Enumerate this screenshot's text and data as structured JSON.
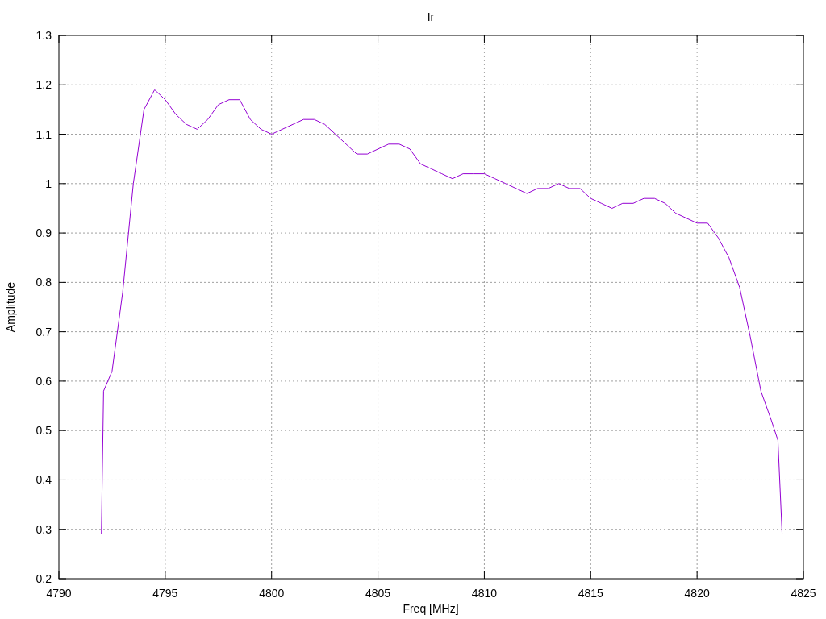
{
  "chart_data": {
    "type": "line",
    "title": "Ir",
    "xlabel": "Freq [MHz]",
    "ylabel": "Amplitude",
    "xlim": [
      4790,
      4825
    ],
    "ylim": [
      0.2,
      1.3
    ],
    "grid": true,
    "xticks": [
      4790,
      4795,
      4800,
      4805,
      4810,
      4815,
      4820,
      4825
    ],
    "yticks": [
      0.2,
      0.3,
      0.4,
      0.5,
      0.6,
      0.7,
      0.8,
      0.9,
      1,
      1.1,
      1.2,
      1.3
    ],
    "x": [
      4792.0,
      4792.1,
      4792.5,
      4793.0,
      4793.5,
      4794.0,
      4794.5,
      4795.0,
      4795.5,
      4796.0,
      4796.5,
      4797.0,
      4797.5,
      4798.0,
      4798.5,
      4799.0,
      4799.5,
      4800.0,
      4800.5,
      4801.0,
      4801.5,
      4802.0,
      4802.5,
      4803.0,
      4803.5,
      4804.0,
      4804.5,
      4805.0,
      4805.5,
      4806.0,
      4806.5,
      4807.0,
      4807.5,
      4808.0,
      4808.5,
      4809.0,
      4809.5,
      4810.0,
      4810.5,
      4811.0,
      4811.5,
      4812.0,
      4812.5,
      4813.0,
      4813.5,
      4814.0,
      4814.5,
      4815.0,
      4815.5,
      4816.0,
      4816.5,
      4817.0,
      4817.5,
      4818.0,
      4818.5,
      4819.0,
      4819.5,
      4820.0,
      4820.5,
      4821.0,
      4821.5,
      4822.0,
      4822.5,
      4823.0,
      4823.5,
      4823.8,
      4824.0
    ],
    "series": [
      {
        "color": "#9400d3",
        "values": [
          0.29,
          0.58,
          0.62,
          0.78,
          1.0,
          1.15,
          1.19,
          1.17,
          1.14,
          1.12,
          1.11,
          1.13,
          1.16,
          1.17,
          1.17,
          1.13,
          1.11,
          1.1,
          1.11,
          1.12,
          1.13,
          1.13,
          1.12,
          1.1,
          1.08,
          1.06,
          1.06,
          1.07,
          1.08,
          1.08,
          1.07,
          1.04,
          1.03,
          1.02,
          1.01,
          1.02,
          1.02,
          1.02,
          1.01,
          1.0,
          0.99,
          0.98,
          0.99,
          0.99,
          1.0,
          0.99,
          0.99,
          0.97,
          0.96,
          0.95,
          0.96,
          0.96,
          0.97,
          0.97,
          0.96,
          0.94,
          0.93,
          0.92,
          0.92,
          0.89,
          0.85,
          0.79,
          0.69,
          0.58,
          0.52,
          0.48,
          0.29
        ]
      }
    ]
  }
}
